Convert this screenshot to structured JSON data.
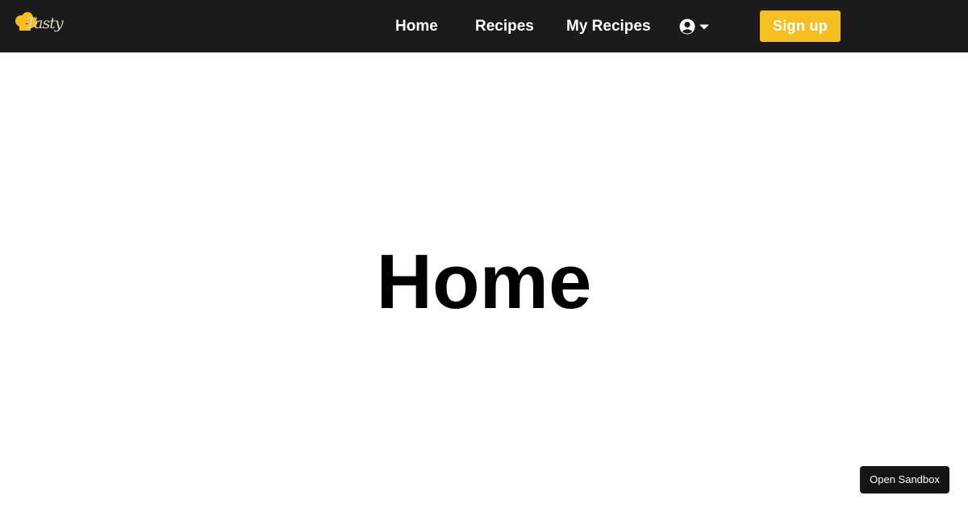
{
  "brand": {
    "logo_text": "Tasty",
    "accent_color": "#f5be22",
    "navbar_color": "#1c1a1a"
  },
  "nav": {
    "items": [
      {
        "label": "Home"
      },
      {
        "label": "Recipes"
      },
      {
        "label": "My Recipes"
      }
    ],
    "user_menu_icon": "user-circle-icon",
    "dropdown_icon": "caret-down-icon",
    "signup_label": "Sign up"
  },
  "main": {
    "title": "Home"
  },
  "sandbox": {
    "label": "Open Sandbox"
  }
}
